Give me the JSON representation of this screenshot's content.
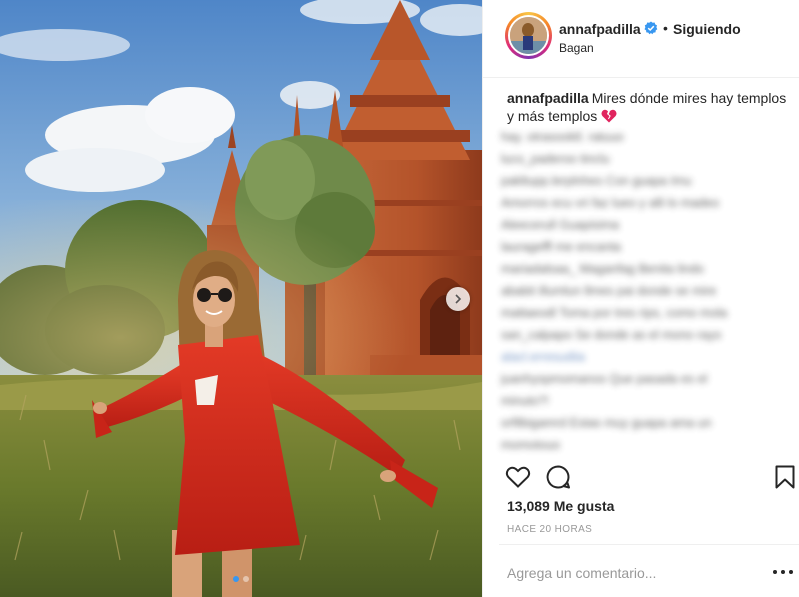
{
  "post": {
    "username": "annafpadilla",
    "separator": "•",
    "follow_label": "Siguiendo",
    "location": "Bagan",
    "verified": true,
    "caption_text": "Mires dónde mires hay templos y más templos",
    "caption_emoji": "broken-heart-icon",
    "likes": "13,089 Me gusta",
    "time": "HACE 20 HORAS",
    "comment_placeholder": "Agrega un comentario...",
    "carousel": {
      "total_slides": 2,
      "current_slide": 1
    }
  },
  "blurred_comments": [
    {
      "user": "",
      "text": "hay. otrasooktl. ratuuo"
    },
    {
      "user": "",
      "text": "luco_paderoo tinclu"
    },
    {
      "user": "",
      "text": "pakltupp.lerplnhes Con guapa Imu"
    },
    {
      "user": "",
      "text": "Amorros ecu vri faz lueo y alli lo madeo"
    },
    {
      "user": "",
      "text": "Aleecerull Guapisima"
    },
    {
      "user": "",
      "text": "laurageffl me encanta"
    },
    {
      "user": "",
      "text": "mariadalsaa_ Maganfag Benita lindo"
    },
    {
      "user": "",
      "text": "ababit illumlun llmes pai donde se mire"
    },
    {
      "user": "",
      "text": "mattaeodl Toma por tres rips, como mola"
    },
    {
      "user": "",
      "text": "san_calpapo Se donde as el mono rayo"
    },
    {
      "user": "",
      "text": "alacl.erresudiia",
      "link": true
    },
    {
      "user": "",
      "text": "juanhyspmomanos Que pasada es el"
    },
    {
      "user": "",
      "text": "minuto?!"
    },
    {
      "user": "",
      "text": "orfilbigamrd Estas muy guapa ama un"
    },
    {
      "user": "",
      "text": "momotouo"
    }
  ],
  "colors": {
    "accent_blue": "#3897f0",
    "text": "#262626",
    "muted": "#999999",
    "divider": "#efefef",
    "dress_red": "#d42a1c",
    "temple_brick": "#b4532a"
  }
}
